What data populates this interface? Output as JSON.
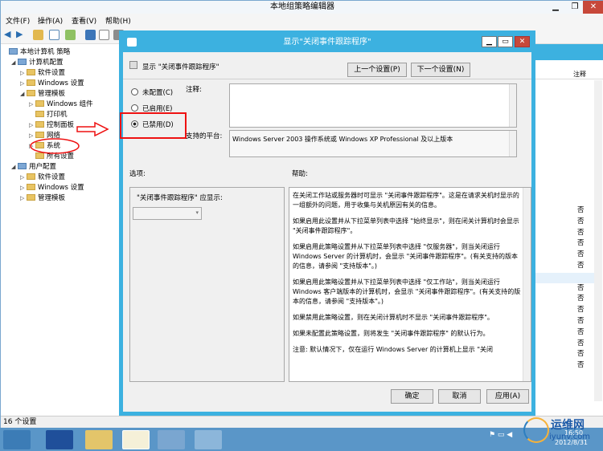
{
  "window": {
    "title": "本地组策略编辑器"
  },
  "menu": [
    "文件(F)",
    "操作(A)",
    "查看(V)",
    "帮助(H)"
  ],
  "tree": [
    {
      "label": "本地计算机 策略",
      "level": 0,
      "arrow": ""
    },
    {
      "label": "计算机配置",
      "level": 1,
      "arrow": "◢"
    },
    {
      "label": "软件设置",
      "level": 2,
      "arrow": "▷"
    },
    {
      "label": "Windows 设置",
      "level": 2,
      "arrow": "▷"
    },
    {
      "label": "管理模板",
      "level": 2,
      "arrow": "◢"
    },
    {
      "label": "Windows 组件",
      "level": 3,
      "arrow": "▷"
    },
    {
      "label": "打印机",
      "level": 3,
      "arrow": ""
    },
    {
      "label": "控制面板",
      "level": 3,
      "arrow": "▷"
    },
    {
      "label": "网络",
      "level": 3,
      "arrow": "▷"
    },
    {
      "label": "系统",
      "level": 3,
      "arrow": "▷"
    },
    {
      "label": "所有设置",
      "level": 3,
      "arrow": ""
    },
    {
      "label": "用户配置",
      "level": 1,
      "arrow": "◢"
    },
    {
      "label": "软件设置",
      "level": 2,
      "arrow": "▷"
    },
    {
      "label": "Windows 设置",
      "level": 2,
      "arrow": "▷"
    },
    {
      "label": "管理模板",
      "level": 2,
      "arrow": "▷"
    }
  ],
  "right_pane": {
    "header": "注释",
    "values": [
      "否",
      "否",
      "否",
      "否",
      "否",
      "否",
      "否",
      "否",
      "否",
      "否",
      "否",
      "否",
      "否",
      "否",
      "否"
    ]
  },
  "status": {
    "text": "16 个设置"
  },
  "dialog": {
    "title": "显示\"关闭事件跟踪程序\"",
    "setting_name": "显示 \"关闭事件跟踪程序\"",
    "prev_button": "上一个设置(P)",
    "next_button": "下一个设置(N)",
    "radio_not_configured": "未配置(C)",
    "radio_enabled": "已启用(E)",
    "radio_disabled": "已禁用(D)",
    "comment_label": "注释:",
    "supported_label": "支持的平台:",
    "supported_value": "Windows Server 2003 操作系统或 Windows XP Professional 及以上版本",
    "options_label": "选项:",
    "help_label": "帮助:",
    "option_text": "\"关闭事件跟踪程序\" 应显示:",
    "help_paragraphs": [
      "在关闭工作站或服务器时可显示 \"关闭事件跟踪程序\"。这是在请求关机时显示的一组额外的问题，用于收集与关机原因有关的信息。",
      "如果启用此设置并从下拉菜单列表中选择 \"始终显示\"，则在闭关计算机时会显示 \"关闭事件跟踪程序\"。",
      "如果启用此策略设置并从下拉菜单列表中选择 \"仅服务器\"，则当关闭运行 Windows Server 的计算机时，会显示 \"关闭事件跟踪程序\"。(有关支持的版本的信息，请参阅 \"支持版本\"。)",
      "如果启用此策略设置并从下拉菜单列表中选择 \"仅工作站\"，则当关闭运行 Windows 客户端版本的计算机时，会显示 \"关闭事件跟踪程序\"。(有关支持的版本的信息，请参阅 \"支持版本\"。)",
      "如果禁用此策略设置，则在关闭计算机时不显示 \"关闭事件跟踪程序\"。",
      "如果未配置此策略设置，则将发生 \"关闭事件跟踪程序\" 的默认行为。",
      "注意: 默认情况下，仅在运行 Windows Server 的计算机上显示 \"关闭"
    ],
    "ok_button": "确定",
    "cancel_button": "取消",
    "apply_button": "应用(A)"
  },
  "clock": {
    "time": "16:50",
    "date": "2012/8/31"
  },
  "watermark": {
    "text": "运维网",
    "url": "iyunv.com"
  }
}
